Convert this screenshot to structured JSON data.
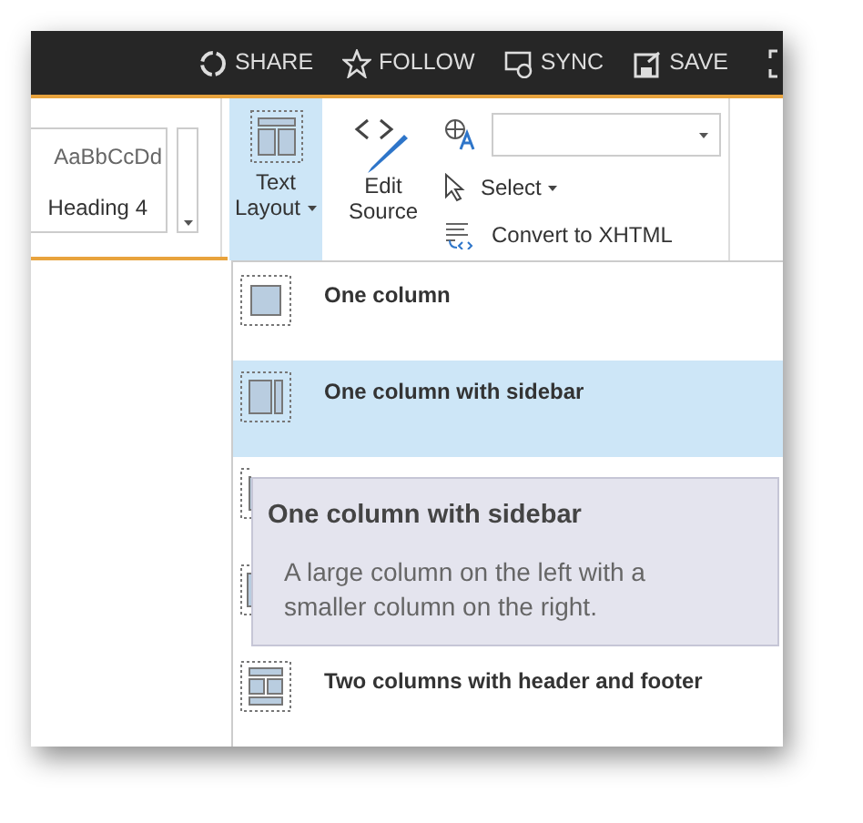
{
  "top_bar": {
    "actions": [
      {
        "label": "SHARE",
        "kind": "share"
      },
      {
        "label": "FOLLOW",
        "kind": "follow"
      },
      {
        "label": "SYNC",
        "kind": "sync"
      },
      {
        "label": "SAVE",
        "kind": "save"
      },
      {
        "kind": "focus"
      }
    ]
  },
  "ribbon": {
    "style_gallery": {
      "sample": "AaBbCcDd",
      "name": "Heading 4"
    },
    "text_layout": {
      "lines": [
        "Text",
        "Layout"
      ],
      "selected": true
    },
    "edit_source": {
      "lines": [
        "Edit",
        "Source"
      ]
    },
    "select": "Select",
    "convert": "Convert to XHTML"
  },
  "layout_menu": {
    "items": [
      {
        "label": "One column",
        "kind": "one",
        "selected": false
      },
      {
        "label": "One column with sidebar",
        "kind": "sidebar",
        "selected": true
      },
      {
        "kind": "two",
        "selected": false
      },
      {
        "kind": "three",
        "selected": false
      },
      {
        "label": "Two columns with header and footer",
        "kind": "header-footer",
        "selected": false
      }
    ]
  },
  "tooltip": {
    "title": "One column with sidebar",
    "text": "A large column on the left with a smaller column on the right."
  }
}
